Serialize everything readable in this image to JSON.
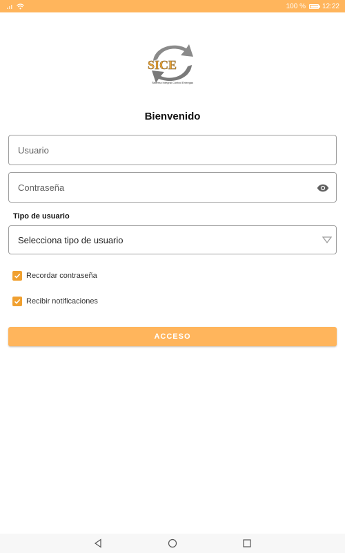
{
  "status_bar": {
    "battery": "100 %",
    "time": "12:22",
    "battery_level": 1.0
  },
  "logo": {
    "mark_text": "SICE",
    "subtitle": "Sistema Integral Control Entregas"
  },
  "title": "Bienvenido",
  "fields": {
    "usuario_placeholder": "Usuario",
    "password_placeholder": "Contraseña"
  },
  "tipo": {
    "label": "Tipo de usuario",
    "selected": "Selecciona tipo de usuario"
  },
  "checks": [
    {
      "label": "Recordar contraseña",
      "checked": true
    },
    {
      "label": "Recibir notificaciones",
      "checked": true
    }
  ],
  "button": {
    "label": "ACCESO"
  },
  "colors": {
    "accent": "#ffb55c",
    "checkbox": "#f0a030"
  },
  "icons": [
    "signal-icon",
    "wifi-icon",
    "battery-icon",
    "eye-icon",
    "dropdown-caret-icon",
    "check-icon",
    "back-icon",
    "home-icon",
    "recents-icon"
  ]
}
